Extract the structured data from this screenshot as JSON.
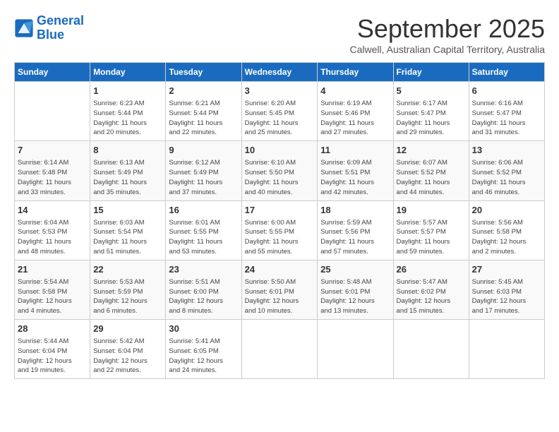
{
  "logo": {
    "line1": "General",
    "line2": "Blue"
  },
  "title": "September 2025",
  "subtitle": "Calwell, Australian Capital Territory, Australia",
  "weekdays": [
    "Sunday",
    "Monday",
    "Tuesday",
    "Wednesday",
    "Thursday",
    "Friday",
    "Saturday"
  ],
  "weeks": [
    [
      {
        "day": "",
        "info": ""
      },
      {
        "day": "1",
        "info": "Sunrise: 6:23 AM\nSunset: 5:44 PM\nDaylight: 11 hours\nand 20 minutes."
      },
      {
        "day": "2",
        "info": "Sunrise: 6:21 AM\nSunset: 5:44 PM\nDaylight: 11 hours\nand 22 minutes."
      },
      {
        "day": "3",
        "info": "Sunrise: 6:20 AM\nSunset: 5:45 PM\nDaylight: 11 hours\nand 25 minutes."
      },
      {
        "day": "4",
        "info": "Sunrise: 6:19 AM\nSunset: 5:46 PM\nDaylight: 11 hours\nand 27 minutes."
      },
      {
        "day": "5",
        "info": "Sunrise: 6:17 AM\nSunset: 5:47 PM\nDaylight: 11 hours\nand 29 minutes."
      },
      {
        "day": "6",
        "info": "Sunrise: 6:16 AM\nSunset: 5:47 PM\nDaylight: 11 hours\nand 31 minutes."
      }
    ],
    [
      {
        "day": "7",
        "info": "Sunrise: 6:14 AM\nSunset: 5:48 PM\nDaylight: 11 hours\nand 33 minutes."
      },
      {
        "day": "8",
        "info": "Sunrise: 6:13 AM\nSunset: 5:49 PM\nDaylight: 11 hours\nand 35 minutes."
      },
      {
        "day": "9",
        "info": "Sunrise: 6:12 AM\nSunset: 5:49 PM\nDaylight: 11 hours\nand 37 minutes."
      },
      {
        "day": "10",
        "info": "Sunrise: 6:10 AM\nSunset: 5:50 PM\nDaylight: 11 hours\nand 40 minutes."
      },
      {
        "day": "11",
        "info": "Sunrise: 6:09 AM\nSunset: 5:51 PM\nDaylight: 11 hours\nand 42 minutes."
      },
      {
        "day": "12",
        "info": "Sunrise: 6:07 AM\nSunset: 5:52 PM\nDaylight: 11 hours\nand 44 minutes."
      },
      {
        "day": "13",
        "info": "Sunrise: 6:06 AM\nSunset: 5:52 PM\nDaylight: 11 hours\nand 46 minutes."
      }
    ],
    [
      {
        "day": "14",
        "info": "Sunrise: 6:04 AM\nSunset: 5:53 PM\nDaylight: 11 hours\nand 48 minutes."
      },
      {
        "day": "15",
        "info": "Sunrise: 6:03 AM\nSunset: 5:54 PM\nDaylight: 11 hours\nand 51 minutes."
      },
      {
        "day": "16",
        "info": "Sunrise: 6:01 AM\nSunset: 5:55 PM\nDaylight: 11 hours\nand 53 minutes."
      },
      {
        "day": "17",
        "info": "Sunrise: 6:00 AM\nSunset: 5:55 PM\nDaylight: 11 hours\nand 55 minutes."
      },
      {
        "day": "18",
        "info": "Sunrise: 5:59 AM\nSunset: 5:56 PM\nDaylight: 11 hours\nand 57 minutes."
      },
      {
        "day": "19",
        "info": "Sunrise: 5:57 AM\nSunset: 5:57 PM\nDaylight: 11 hours\nand 59 minutes."
      },
      {
        "day": "20",
        "info": "Sunrise: 5:56 AM\nSunset: 5:58 PM\nDaylight: 12 hours\nand 2 minutes."
      }
    ],
    [
      {
        "day": "21",
        "info": "Sunrise: 5:54 AM\nSunset: 5:58 PM\nDaylight: 12 hours\nand 4 minutes."
      },
      {
        "day": "22",
        "info": "Sunrise: 5:53 AM\nSunset: 5:59 PM\nDaylight: 12 hours\nand 6 minutes."
      },
      {
        "day": "23",
        "info": "Sunrise: 5:51 AM\nSunset: 6:00 PM\nDaylight: 12 hours\nand 8 minutes."
      },
      {
        "day": "24",
        "info": "Sunrise: 5:50 AM\nSunset: 6:01 PM\nDaylight: 12 hours\nand 10 minutes."
      },
      {
        "day": "25",
        "info": "Sunrise: 5:48 AM\nSunset: 6:01 PM\nDaylight: 12 hours\nand 13 minutes."
      },
      {
        "day": "26",
        "info": "Sunrise: 5:47 AM\nSunset: 6:02 PM\nDaylight: 12 hours\nand 15 minutes."
      },
      {
        "day": "27",
        "info": "Sunrise: 5:45 AM\nSunset: 6:03 PM\nDaylight: 12 hours\nand 17 minutes."
      }
    ],
    [
      {
        "day": "28",
        "info": "Sunrise: 5:44 AM\nSunset: 6:04 PM\nDaylight: 12 hours\nand 19 minutes."
      },
      {
        "day": "29",
        "info": "Sunrise: 5:42 AM\nSunset: 6:04 PM\nDaylight: 12 hours\nand 22 minutes."
      },
      {
        "day": "30",
        "info": "Sunrise: 5:41 AM\nSunset: 6:05 PM\nDaylight: 12 hours\nand 24 minutes."
      },
      {
        "day": "",
        "info": ""
      },
      {
        "day": "",
        "info": ""
      },
      {
        "day": "",
        "info": ""
      },
      {
        "day": "",
        "info": ""
      }
    ]
  ]
}
